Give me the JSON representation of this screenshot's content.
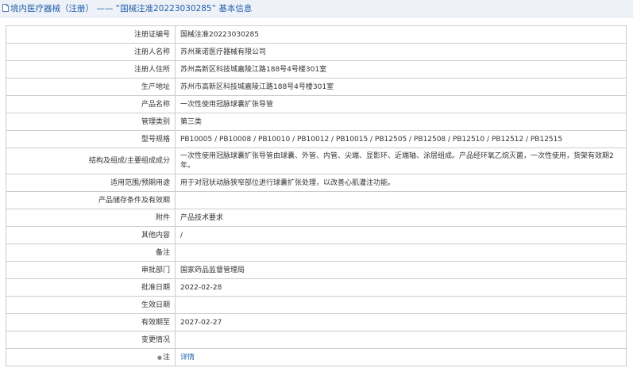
{
  "header": {
    "title": "境内医疗器械（注册） —— “国械注准20223030285” 基本信息"
  },
  "rows": [
    {
      "label": "注册证编号",
      "value": "国械注准20223030285"
    },
    {
      "label": "注册人名称",
      "value": "苏州莱诺医疗器械有限公司"
    },
    {
      "label": "注册人住所",
      "value": "苏州高新区科技城嘉陵江路188号4号楼301室"
    },
    {
      "label": "生产地址",
      "value": "苏州市高新区科技城嘉陵江路188号4号楼301室"
    },
    {
      "label": "产品名称",
      "value": "一次性使用冠脉球囊扩张导管"
    },
    {
      "label": "管理类别",
      "value": "第三类"
    },
    {
      "label": "型号规格",
      "value": "PB10005 / PB10008 / PB10010 / PB10012 / PB10015 / PB12505 / PB12508 / PB12510 / PB12512 / PB12515"
    },
    {
      "label": "结构及组成/主要组成成分",
      "value": "一次性使用冠脉球囊扩张导管由球囊、外管、内管、尖端、显影环、近端轴、涂层组成。产品经环氧乙烷灭菌，一次性使用，货架有效期2年。"
    },
    {
      "label": "适用范围/预期用途",
      "value": "用于对冠状动脉狭窄部位进行球囊扩张处理，以改善心肌灌注功能。"
    },
    {
      "label": "产品储存条件及有效期",
      "value": ""
    },
    {
      "label": "附件",
      "value": "产品技术要求"
    },
    {
      "label": "其他内容",
      "value": "/"
    },
    {
      "label": "备注",
      "value": ""
    },
    {
      "label": "审批部门",
      "value": "国家药品监督管理局"
    },
    {
      "label": "批准日期",
      "value": "2022-02-28"
    },
    {
      "label": "生效日期",
      "value": ""
    },
    {
      "label": "有效期至",
      "value": "2027-02-27"
    },
    {
      "label": "变更情况",
      "value": ""
    }
  ],
  "note_row": {
    "bullet_icon": "bullet-dot-icon",
    "label": "注",
    "link_text": "详情"
  },
  "colors": {
    "title_text": "#1f5fa8",
    "header_bg": "#eef2f8",
    "border": "#cccccc",
    "link": "#1f5fa8"
  }
}
